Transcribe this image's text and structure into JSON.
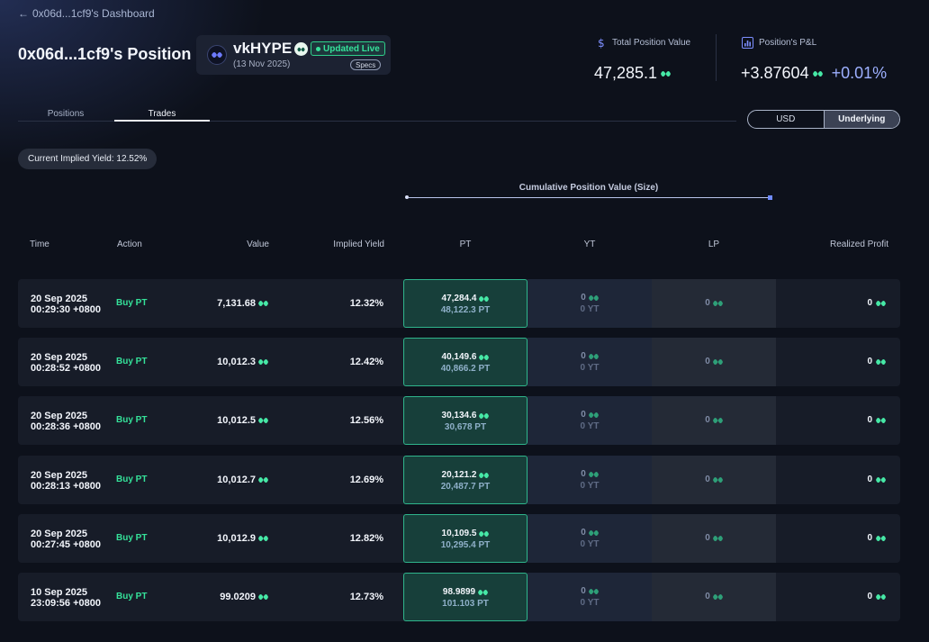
{
  "nav": {
    "back_label": "0x06d...1cf9's Dashboard"
  },
  "page": {
    "title": "0x06d...1cf9's Position"
  },
  "asset": {
    "name": "vkHYPE",
    "date": "(13 Nov 2025)",
    "live_label": "Updated Live",
    "specs_label": "Specs"
  },
  "stats": {
    "total_label": "Total Position Value",
    "total_value": "47,285.1",
    "pnl_label": "Position's P&L",
    "pnl_value": "+3.87604",
    "pnl_pct": "+0.01%"
  },
  "tabs": [
    {
      "label": "Positions"
    },
    {
      "label": "Trades"
    }
  ],
  "toggle": {
    "usd": "USD",
    "underlying": "Underlying"
  },
  "implied_yield_pill": "Current Implied Yield: 12.52%",
  "cumulative_label": "Cumulative Position Value (Size)",
  "columns": {
    "time": "Time",
    "action": "Action",
    "value": "Value",
    "implied_yield": "Implied Yield",
    "pt": "PT",
    "yt": "YT",
    "lp": "LP",
    "realized_profit": "Realized Profit"
  },
  "rows": [
    {
      "date": "20 Sep 2025",
      "time": "00:29:30 +0800",
      "action": "Buy PT",
      "value": "7,131.68",
      "implied_yield": "12.32%",
      "pt_value": "47,284.4",
      "pt_amount": "48,122.3 PT",
      "yt_value": "0",
      "yt_amount": "0 YT",
      "lp": "0",
      "profit": "0"
    },
    {
      "date": "20 Sep 2025",
      "time": "00:28:52 +0800",
      "action": "Buy PT",
      "value": "10,012.3",
      "implied_yield": "12.42%",
      "pt_value": "40,149.6",
      "pt_amount": "40,866.2 PT",
      "yt_value": "0",
      "yt_amount": "0 YT",
      "lp": "0",
      "profit": "0"
    },
    {
      "date": "20 Sep 2025",
      "time": "00:28:36 +0800",
      "action": "Buy PT",
      "value": "10,012.5",
      "implied_yield": "12.56%",
      "pt_value": "30,134.6",
      "pt_amount": "30,678 PT",
      "yt_value": "0",
      "yt_amount": "0 YT",
      "lp": "0",
      "profit": "0"
    },
    {
      "date": "20 Sep 2025",
      "time": "00:28:13 +0800",
      "action": "Buy PT",
      "value": "10,012.7",
      "implied_yield": "12.69%",
      "pt_value": "20,121.2",
      "pt_amount": "20,487.7 PT",
      "yt_value": "0",
      "yt_amount": "0 YT",
      "lp": "0",
      "profit": "0"
    },
    {
      "date": "20 Sep 2025",
      "time": "00:27:45 +0800",
      "action": "Buy PT",
      "value": "10,012.9",
      "implied_yield": "12.82%",
      "pt_value": "10,109.5",
      "pt_amount": "10,295.4 PT",
      "yt_value": "0",
      "yt_amount": "0 YT",
      "lp": "0",
      "profit": "0"
    },
    {
      "date": "10 Sep 2025",
      "time": "23:09:56 +0800",
      "action": "Buy PT",
      "value": "99.0209",
      "implied_yield": "12.73%",
      "pt_value": "98.9899",
      "pt_amount": "101.103 PT",
      "yt_value": "0",
      "yt_amount": "0 YT",
      "lp": "0",
      "profit": "0"
    }
  ]
}
